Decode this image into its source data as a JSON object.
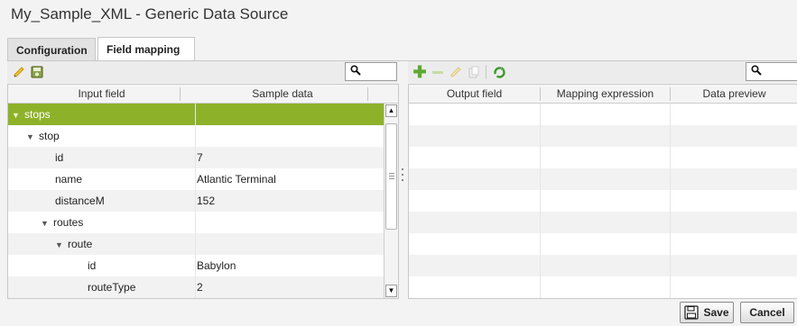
{
  "window": {
    "title": "My_Sample_XML - Generic Data Source"
  },
  "tabs": [
    {
      "label": "Configuration"
    },
    {
      "label": "Field mapping"
    }
  ],
  "left_panel": {
    "columns": [
      "Input field",
      "Sample data"
    ],
    "rows": [
      {
        "field": "stops",
        "value": "",
        "expanded": true,
        "selected": true
      },
      {
        "field": "stop",
        "value": "",
        "expanded": true
      },
      {
        "field": "id",
        "value": "7"
      },
      {
        "field": "name",
        "value": "Atlantic Terminal"
      },
      {
        "field": "distanceM",
        "value": "152"
      },
      {
        "field": "routes",
        "value": "",
        "expanded": true
      },
      {
        "field": "route",
        "value": "",
        "expanded": true
      },
      {
        "field": "id",
        "value": "Babylon"
      },
      {
        "field": "routeType",
        "value": "2"
      }
    ]
  },
  "right_panel": {
    "columns": [
      "Output field",
      "Mapping expression",
      "Data preview"
    ]
  },
  "buttons": {
    "save": "Save",
    "cancel": "Cancel"
  },
  "colors": {
    "selected_row": "#8db22a",
    "alt_row": "#f2f2f2",
    "accent_green": "#5ea832"
  }
}
